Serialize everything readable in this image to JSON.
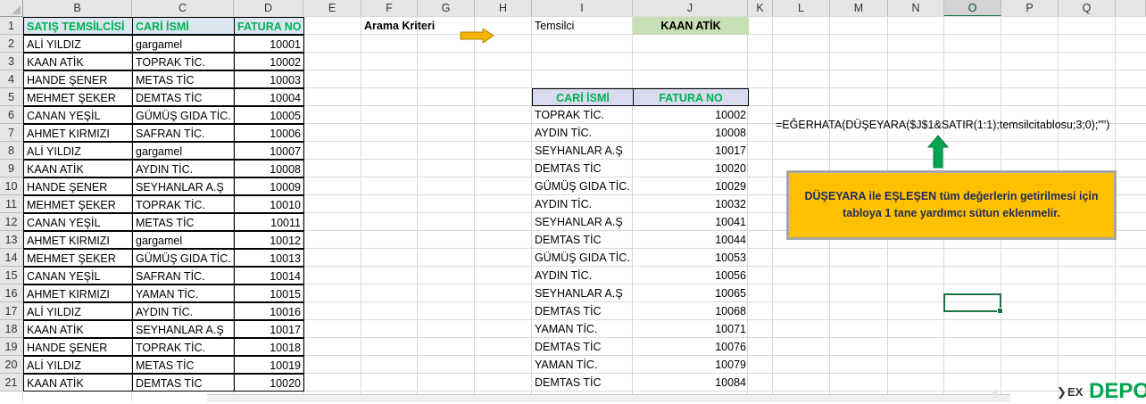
{
  "columns": [
    "B",
    "C",
    "D",
    "E",
    "F",
    "G",
    "H",
    "I",
    "J",
    "K",
    "L",
    "M",
    "N",
    "O",
    "P",
    "Q"
  ],
  "selected_column": "O",
  "rows": [
    "1",
    "2",
    "3",
    "4",
    "5",
    "6",
    "7",
    "8",
    "9",
    "10",
    "11",
    "12",
    "13",
    "14",
    "15",
    "16",
    "17",
    "18",
    "19",
    "20",
    "21"
  ],
  "table1": {
    "headers": [
      "SATIŞ TEMSİLCİSİ",
      "CARİ İSMİ",
      "FATURA NO"
    ],
    "rows": [
      [
        "ALİ YILDIZ",
        "gargamel",
        "10001"
      ],
      [
        "KAAN ATİK",
        "TOPRAK TİC.",
        "10002"
      ],
      [
        "HANDE ŞENER",
        "METAS TİC",
        "10003"
      ],
      [
        "MEHMET ŞEKER",
        "DEMTAS TİC",
        "10004"
      ],
      [
        "CANAN YEŞİL",
        "GÜMÜŞ GIDA TİC.",
        "10005"
      ],
      [
        "AHMET KIRMIZI",
        "SAFRAN TİC.",
        "10006"
      ],
      [
        "ALİ YILDIZ",
        "gargamel",
        "10007"
      ],
      [
        "KAAN ATİK",
        "AYDIN TİC.",
        "10008"
      ],
      [
        "HANDE ŞENER",
        "SEYHANLAR A.Ş",
        "10009"
      ],
      [
        "MEHMET ŞEKER",
        "TOPRAK TİC.",
        "10010"
      ],
      [
        "CANAN YEŞİL",
        "METAS TİC",
        "10011"
      ],
      [
        "AHMET KIRMIZI",
        "gargamel",
        "10012"
      ],
      [
        "MEHMET ŞEKER",
        "GÜMÜŞ GIDA TİC.",
        "10013"
      ],
      [
        "CANAN YEŞİL",
        "SAFRAN TİC.",
        "10014"
      ],
      [
        "AHMET KIRMIZI",
        "YAMAN TİC.",
        "10015"
      ],
      [
        "ALİ YILDIZ",
        "AYDIN TİC.",
        "10016"
      ],
      [
        "KAAN ATİK",
        "SEYHANLAR A.Ş",
        "10017"
      ],
      [
        "HANDE ŞENER",
        "TOPRAK TİC.",
        "10018"
      ],
      [
        "ALİ YILDIZ",
        "METAS TİC",
        "10019"
      ],
      [
        "KAAN ATİK",
        "DEMTAS TİC",
        "10020"
      ]
    ]
  },
  "criteria": {
    "label": "Arama Kriteri",
    "field_label": "Temsilci",
    "value": "KAAN ATİK"
  },
  "results": {
    "headers": [
      "CARİ İSMİ",
      "FATURA NO"
    ],
    "rows": [
      [
        "TOPRAK TİC.",
        "10002"
      ],
      [
        "AYDIN TİC.",
        "10008"
      ],
      [
        "SEYHANLAR A.Ş",
        "10017"
      ],
      [
        "DEMTAS TİC",
        "10020"
      ],
      [
        "GÜMÜŞ GIDA TİC.",
        "10029"
      ],
      [
        "AYDIN TİC.",
        "10032"
      ],
      [
        "SEYHANLAR A.Ş",
        "10041"
      ],
      [
        "DEMTAS TİC",
        "10044"
      ],
      [
        "GÜMÜŞ GIDA TİC.",
        "10053"
      ],
      [
        "AYDIN TİC.",
        "10056"
      ],
      [
        "SEYHANLAR A.Ş",
        "10065"
      ],
      [
        "DEMTAS TİC",
        "10068"
      ],
      [
        "YAMAN TİC.",
        "10071"
      ],
      [
        "DEMTAS TİC",
        "10076"
      ],
      [
        "YAMAN TİC.",
        "10079"
      ],
      [
        "DEMTAS TİC",
        "10084"
      ]
    ]
  },
  "formula_text": "=EĞERHATA(DÜŞEYARA($J$1&SATIR(1:1);temsilcitablosu;3;0);\"\")",
  "note": {
    "line1": "DÜŞEYARA ile EŞLEŞEN tüm değerlerin getirilmesi için",
    "line2": "tabloya 1 tane yardımcı sütun eklenmelir."
  },
  "brand": {
    "prefix": "EX",
    "name": "DEPO"
  },
  "colors": {
    "header_green_text": "#00b050",
    "header_blue_bg": "#dce6f1",
    "criteria_bg": "#c6dfb4",
    "note_bg": "#ffc000",
    "arrow_orange": "#f2b400",
    "arrow_green": "#00a550",
    "selection": "#1e7145"
  }
}
